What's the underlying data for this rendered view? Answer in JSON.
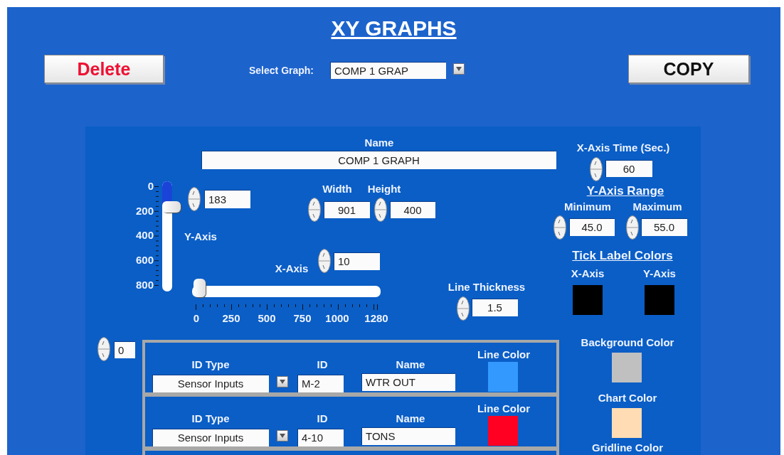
{
  "title": "XY GRAPHS",
  "delete_button": "Delete",
  "copy_button": "COPY",
  "select_graph": {
    "label": "Select Graph:",
    "value": "COMP 1 GRAP"
  },
  "name": {
    "label": "Name",
    "value": "COMP 1 GRAPH"
  },
  "x_axis_time": {
    "label": "X-Axis Time (Sec.)",
    "value": "60"
  },
  "y_axis": {
    "label": "Y-Axis",
    "value": "183",
    "level": 0.23,
    "ticks": [
      "0",
      "200",
      "400",
      "600",
      "800"
    ]
  },
  "x_axis": {
    "label": "X-Axis",
    "value": "10",
    "level": 0.01,
    "ticks": [
      "0",
      "250",
      "500",
      "750",
      "1000",
      "1280"
    ]
  },
  "width": {
    "label": "Width",
    "value": "901"
  },
  "height": {
    "label": "Height",
    "value": "400"
  },
  "y_axis_range": {
    "title": "Y-Axis Range",
    "minimum": {
      "label": "Minimum",
      "value": "45.0"
    },
    "maximum": {
      "label": "Maximum",
      "value": "55.0"
    }
  },
  "tick_label_colors": {
    "title": "Tick Label Colors",
    "items": [
      {
        "label": "X-Axis",
        "color": "#000000"
      },
      {
        "label": "Y-Axis",
        "color": "#000000"
      }
    ]
  },
  "line_thickness": {
    "label": "Line Thickness",
    "value": "1.5"
  },
  "background_color": {
    "label": "Background Color",
    "color": "#c0c0c0"
  },
  "chart_color": {
    "label": "Chart Color",
    "color": "#ffdcb4"
  },
  "gridline_color": {
    "label": "Gridline Color"
  },
  "channel_index": "0",
  "channels": [
    {
      "id_type_label": "ID Type",
      "id_type": "Sensor Inputs",
      "id_label": "ID",
      "id": "M-2",
      "name_label": "Name",
      "name": "WTR OUT",
      "line_color_label": "Line Color",
      "color": "#3399ff"
    },
    {
      "id_type_label": "ID Type",
      "id_type": "Sensor Inputs",
      "id_label": "ID",
      "id": "4-10",
      "name_label": "Name",
      "name": "TONS",
      "line_color_label": "Line Color",
      "color": "#ff0022"
    }
  ]
}
